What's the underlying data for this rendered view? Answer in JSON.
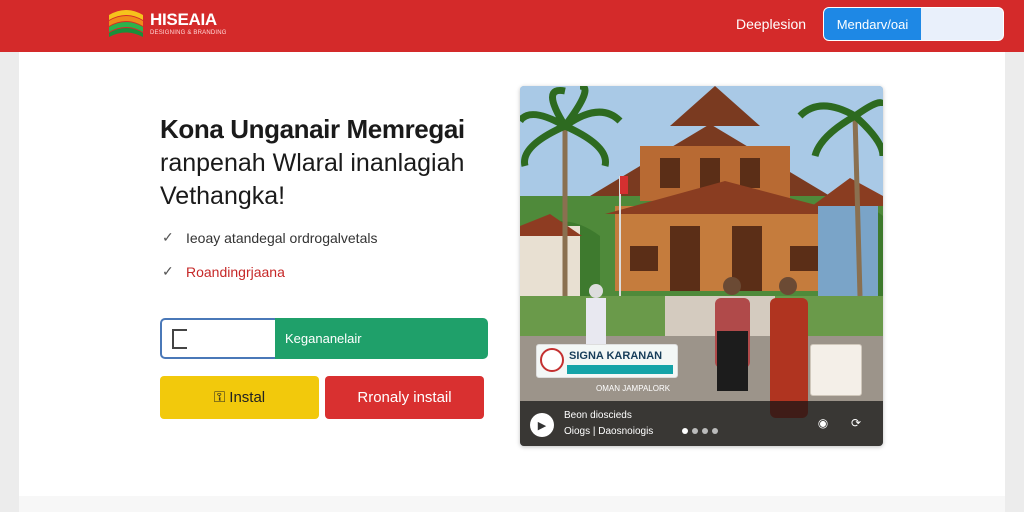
{
  "header": {
    "brand": "HISEAIA",
    "brand_sub": "DESIGNING & BRANDING",
    "nav_link": "Deeplesion",
    "cta_label": "Mendarv/oai"
  },
  "hero": {
    "title_line1": "Kona Unganair Memregai",
    "title_line2": "ranpenah Wlaral inanlagiah",
    "title_line3": "Vethangka!",
    "features": [
      {
        "text": "Ieoay atandegal ordrogalvetals"
      },
      {
        "text": "Roandingrjaana"
      }
    ],
    "email_button": "Kegananelair",
    "install_button": "Instal",
    "install_icon": "key-icon",
    "install2_button": "Rronaly instail"
  },
  "photo": {
    "badge_title": "SIGNA KARANAN",
    "badge_sub": "OMAN JAMPALORK",
    "caption_line1": "Beon  dioscieds",
    "caption_line2": "Oiogs |  Daosnoiogis",
    "dots_total": 4,
    "dots_active_index": 0
  },
  "colors": {
    "header_red": "#d42a2a",
    "cta_blue": "#1e88e5",
    "email_green": "#1fa06a",
    "install_yellow": "#f2c90c",
    "install2_red": "#d93030"
  }
}
